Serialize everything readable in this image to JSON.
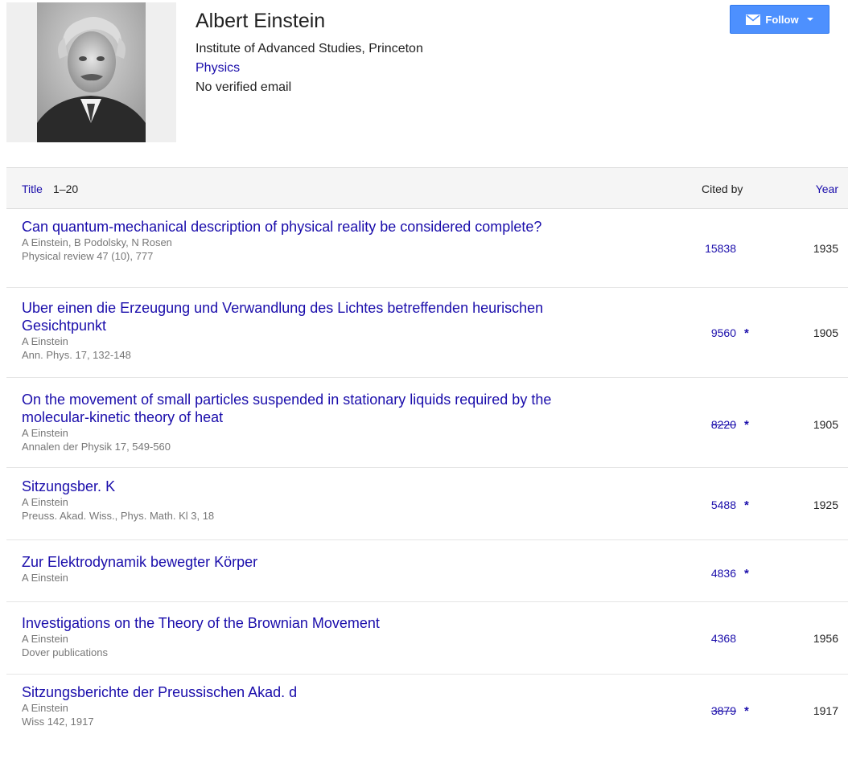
{
  "profile": {
    "name": "Albert Einstein",
    "affiliation": "Institute of Advanced Studies, Princeton",
    "field": "Physics",
    "email": "No verified email",
    "follow_label": "Follow"
  },
  "table": {
    "header": {
      "title": "Title",
      "range": "1–20",
      "cited_by": "Cited by",
      "year": "Year"
    },
    "rows": [
      {
        "title": "Can quantum-mechanical description of physical reality be considered complete?",
        "authors": "A Einstein, B Podolsky, N Rosen",
        "venue": "Physical review 47 (10), 777",
        "cited": "15838",
        "star": "",
        "year": "1935"
      },
      {
        "title": "Uber einen die Erzeugung und Verwandlung des Lichtes betreffenden heurischen Gesichtpunkt",
        "authors": "A Einstein",
        "venue": "Ann. Phys. 17, 132-148",
        "cited": "9560",
        "star": "*",
        "year": "1905"
      },
      {
        "title": "On the movement of small particles suspended in stationary liquids required by the molecular-kinetic theory of heat",
        "authors": "A Einstein",
        "venue": "Annalen der Physik 17, 549-560",
        "cited": "8220",
        "star": "*",
        "year": "1905"
      },
      {
        "title": "Sitzungsber. K",
        "authors": "A Einstein",
        "venue": "Preuss. Akad. Wiss., Phys. Math. Kl 3, 18",
        "cited": "5488",
        "star": "*",
        "year": "1925"
      },
      {
        "title": "Zur Elektrodynamik bewegter Körper",
        "authors": "A Einstein",
        "venue": "",
        "cited": "4836",
        "star": "*",
        "year": ""
      },
      {
        "title": "Investigations on the Theory of the Brownian Movement",
        "authors": "A Einstein",
        "venue": "Dover publications",
        "cited": "4368",
        "star": "",
        "year": "1956"
      },
      {
        "title": "Sitzungsberichte der Preussischen Akad. d",
        "authors": "A Einstein",
        "venue": "Wiss 142, 1917",
        "cited": "3879",
        "star": "*",
        "year": "1917"
      }
    ]
  },
  "colors": {
    "link": "#1a0dab",
    "follow_button": "#4d90fe",
    "header_bg": "#f5f5f5",
    "muted_text": "#777777"
  },
  "icons": {
    "follow": "mail-icon",
    "dropdown": "caret-down-icon",
    "merged_citation": "star-icon"
  }
}
